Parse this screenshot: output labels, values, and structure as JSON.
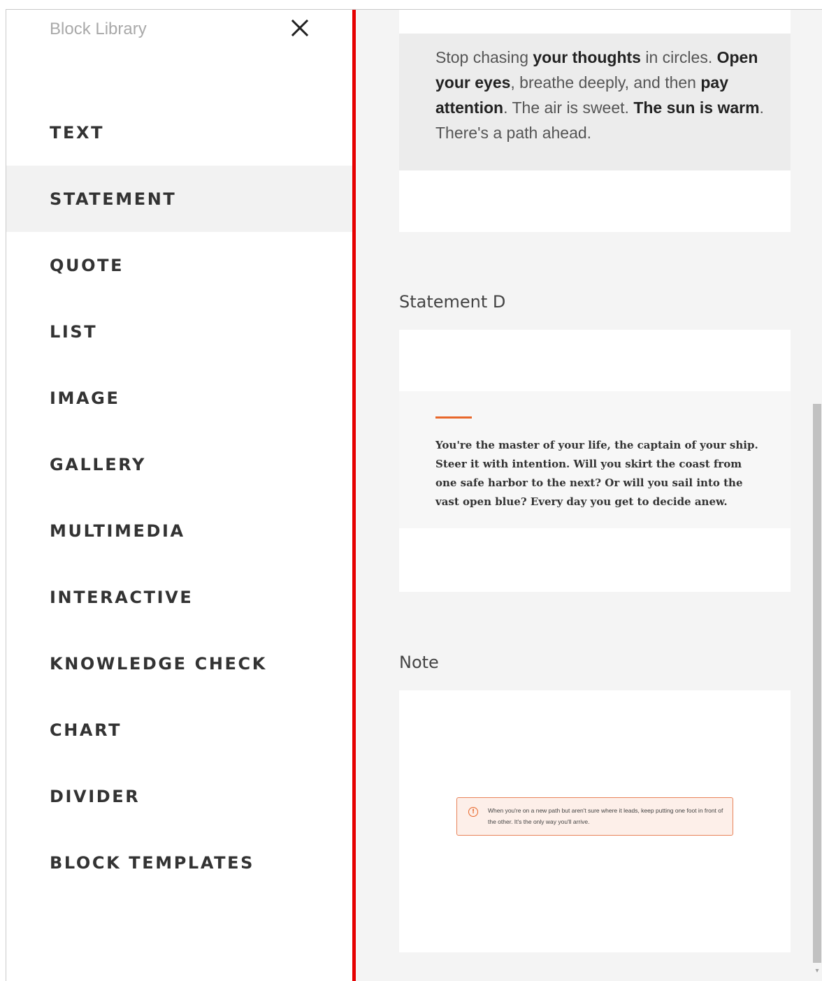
{
  "sidebar": {
    "title": "Block Library",
    "close_icon": "close-icon",
    "items": [
      {
        "label": "TEXT",
        "active": false
      },
      {
        "label": "STATEMENT",
        "active": true
      },
      {
        "label": "QUOTE",
        "active": false
      },
      {
        "label": "LIST",
        "active": false
      },
      {
        "label": "IMAGE",
        "active": false
      },
      {
        "label": "GALLERY",
        "active": false
      },
      {
        "label": "MULTIMEDIA",
        "active": false
      },
      {
        "label": "INTERACTIVE",
        "active": false
      },
      {
        "label": "KNOWLEDGE CHECK",
        "active": false
      },
      {
        "label": "CHART",
        "active": false
      },
      {
        "label": "DIVIDER",
        "active": false
      },
      {
        "label": "BLOCK TEMPLATES",
        "active": false
      }
    ]
  },
  "content": {
    "statement_a": {
      "segments": [
        {
          "text": "Stop chasing ",
          "bold": false
        },
        {
          "text": "your thoughts",
          "bold": true
        },
        {
          "text": " in circles. ",
          "bold": false
        },
        {
          "text": "Open your eyes",
          "bold": true
        },
        {
          "text": ", breathe deeply, and then ",
          "bold": false
        },
        {
          "text": "pay attention",
          "bold": true
        },
        {
          "text": ". The air is sweet. ",
          "bold": false
        },
        {
          "text": "The sun is warm",
          "bold": true
        },
        {
          "text": ". There's a path ahead.",
          "bold": false
        }
      ]
    },
    "statement_d": {
      "label": "Statement D",
      "text": "You're the master of your life, the captain of your ship. Steer it with intention. Will you skirt the coast from one safe harbor to the next? Or will you sail into the vast open blue? Every day you get to decide anew."
    },
    "note": {
      "label": "Note",
      "icon": "info-icon",
      "text": "When you're on a new path but aren't sure where it leads, keep putting one foot in front of the other. It's the only way you'll arrive."
    }
  },
  "colors": {
    "divider": "#e60000",
    "accent": "#e8672a",
    "active_item_bg": "#f2f2f2",
    "note_bg": "#fdefe9",
    "note_border": "#e8835a"
  }
}
